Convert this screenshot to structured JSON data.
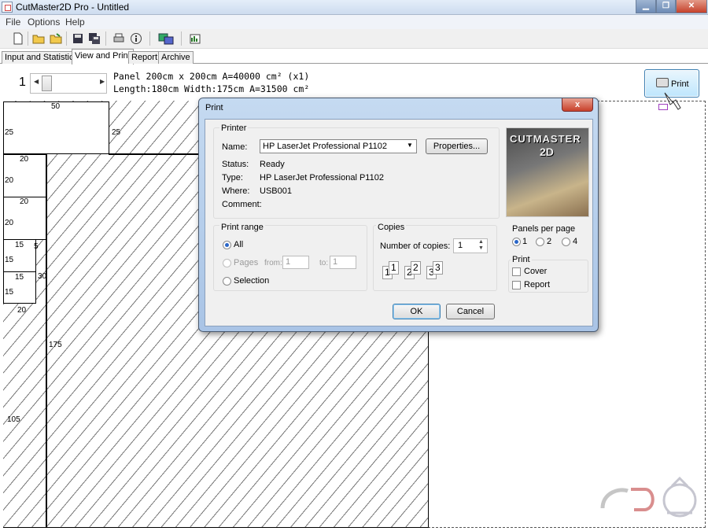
{
  "window": {
    "title": "CutMaster2D Pro - Untitled",
    "min": "▁",
    "max": "❐",
    "close": "✕"
  },
  "menu": [
    "File",
    "Options",
    "Help"
  ],
  "toolbar_icons": [
    "new-file-icon",
    "open-folder-icon",
    "open-project-icon",
    "save-icon",
    "save-all-icon",
    "print-icon",
    "info-icon",
    "export-icon",
    "chart-icon"
  ],
  "tabs": [
    "Input and Statistics",
    "View and Print",
    "Report",
    "Archive"
  ],
  "panel": {
    "index": "1",
    "line1": "Panel 200cm x 200cm A=40000 cm² (x1)",
    "line2": "Length:180cm Width:175cm A=31500 cm²"
  },
  "print_button": "Print",
  "layout_labels": {
    "top_w": "50",
    "top_h": "25",
    "top_right_h": "25",
    "p1_w": "20",
    "p1_h": "20",
    "p2_w": "20",
    "p2_h": "20",
    "p3_w": "15",
    "p3_h": "15",
    "p3_side": "5",
    "p4_w": "15",
    "p4_h": "15",
    "p4_side": "30",
    "strip_w": "20",
    "strip_h": "105",
    "waste_h": "175"
  },
  "dialog": {
    "title": "Print",
    "close": "x",
    "printer_group": "Printer",
    "name_label": "Name:",
    "name_value": "HP LaserJet Professional P1102",
    "properties": "Properties...",
    "status_label": "Status:",
    "status_value": "Ready",
    "type_label": "Type:",
    "type_value": "HP LaserJet Professional P1102",
    "where_label": "Where:",
    "where_value": "USB001",
    "comment_label": "Comment:",
    "comment_value": "",
    "brand_1": "CUTMASTER",
    "brand_2": "2D",
    "range_group": "Print range",
    "range_all": "All",
    "range_pages": "Pages",
    "range_from": "from:",
    "range_from_val": "1",
    "range_to": "to:",
    "range_to_val": "1",
    "range_selection": "Selection",
    "copies_group": "Copies",
    "copies_label": "Number of copies:",
    "copies_value": "1",
    "collate": [
      "1",
      "1",
      "2",
      "2",
      "3",
      "3"
    ],
    "ppp_group": "Panels per page",
    "ppp": [
      "1",
      "2",
      "4"
    ],
    "print_group": "Print",
    "cover": "Cover",
    "report": "Report",
    "ok": "OK",
    "cancel": "Cancel"
  }
}
